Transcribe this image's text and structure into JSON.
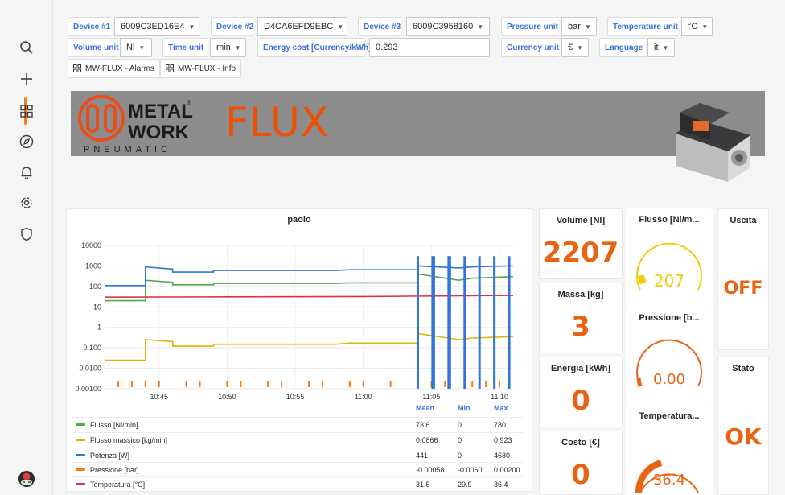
{
  "sidebar": {
    "icons": [
      "search-icon",
      "plus-icon",
      "dashboards-icon",
      "explore-icon",
      "alerting-icon",
      "settings-icon",
      "shield-icon",
      "user-avatar"
    ]
  },
  "variables": {
    "device1": {
      "label": "Device #1",
      "value": "6009C3ED16E4"
    },
    "device2": {
      "label": "Device #2",
      "value": "D4CA6EFD9EBC"
    },
    "device3": {
      "label": "Device #3",
      "value": "6009C3958160"
    },
    "pressure_unit": {
      "label": "Pressure unit",
      "value": "bar"
    },
    "temperature_unit": {
      "label": "Temperature unit",
      "value": "°C"
    },
    "volume_unit": {
      "label": "Volume unit",
      "value": "Nl"
    },
    "time_unit": {
      "label": "Time unit",
      "value": "min"
    },
    "energy_cost": {
      "label": "Energy cost [Currency/kWh]",
      "value": "0.293"
    },
    "currency_unit": {
      "label": "Currency unit",
      "value": "€"
    },
    "language": {
      "label": "Language",
      "value": "it"
    }
  },
  "links": {
    "alarms": "MW-FLUX - Alarms",
    "info": "MW-FLUX - Info"
  },
  "banner": {
    "logo_line1": "METAL",
    "logo_line2": "WORK",
    "logo_sub": "PNEUMATIC",
    "logo_reg": "®",
    "product": "FLUX"
  },
  "chart_panel": {
    "title": "paolo",
    "legend_headers": {
      "mean": "Mean",
      "min": "Min",
      "max": "Max"
    }
  },
  "chart_data": {
    "type": "line",
    "title": "paolo",
    "y_scale": "log",
    "ylim": [
      0.001,
      10000
    ],
    "y_ticks": [
      "10000",
      "1000",
      "100",
      "10",
      "1",
      "0.100",
      "0.0100",
      "0.00100"
    ],
    "x_ticks": [
      "10:45",
      "10:50",
      "10:55",
      "11:00",
      "11:05",
      "11:10"
    ],
    "grid": true,
    "legend_placement": "bottom",
    "series": [
      {
        "name": "Flusso [Nl/min]",
        "color": "#56a64b",
        "mean": "73.6",
        "min": "0",
        "max": "780",
        "x": [
          "10:41",
          "10:44",
          "10:44",
          "10:46",
          "10:46",
          "10:49",
          "10:49",
          "10:58",
          "10:59",
          "11:04",
          "11:04",
          "11:07",
          "11:08",
          "11:11"
        ],
        "y": [
          20,
          20,
          200,
          160,
          120,
          120,
          140,
          140,
          150,
          150,
          400,
          200,
          250,
          300
        ]
      },
      {
        "name": "Flusso massico [kg/min]",
        "color": "#e0b400",
        "mean": "0.0866",
        "min": "0",
        "max": "0.923",
        "x": [
          "10:41",
          "10:44",
          "10:44",
          "10:46",
          "10:46",
          "10:49",
          "10:49",
          "10:58",
          "10:59",
          "11:04",
          "11:04",
          "11:07",
          "11:08",
          "11:11"
        ],
        "y": [
          0.025,
          0.025,
          0.25,
          0.2,
          0.12,
          0.12,
          0.15,
          0.15,
          0.17,
          0.17,
          0.5,
          0.25,
          0.3,
          0.35
        ]
      },
      {
        "name": "Potenza [W]",
        "color": "#3274d9",
        "mean": "441",
        "min": "0",
        "max": "4680",
        "x": [
          "10:41",
          "10:44",
          "10:44",
          "10:46",
          "10:46",
          "10:49",
          "10:49",
          "10:58",
          "10:59",
          "11:04",
          "11:04",
          "11:07",
          "11:08",
          "11:11"
        ],
        "y": [
          110,
          110,
          900,
          700,
          500,
          500,
          600,
          600,
          650,
          650,
          1000,
          800,
          900,
          1000
        ]
      },
      {
        "name": "Pressione [bar]",
        "color": "#ff780a",
        "mean": "-0.00058",
        "min": "-0.0060",
        "max": "0.00200",
        "x": [
          "10:41",
          "11:11"
        ],
        "y": [
          0.001,
          0.001
        ]
      },
      {
        "name": "Temperatura [°C]",
        "color": "#e02f44",
        "mean": "31.5",
        "min": "29.9",
        "max": "36.4",
        "x": [
          "10:41",
          "10:50",
          "11:00",
          "11:11"
        ],
        "y": [
          30,
          31,
          32,
          36
        ]
      }
    ]
  },
  "stats": {
    "volume": {
      "title": "Volume [Nl]",
      "value": "2207"
    },
    "massa": {
      "title": "Massa [kg]",
      "value": "3"
    },
    "energia": {
      "title": "Energia [kWh]",
      "value": "0"
    },
    "costo": {
      "title": "Costo [€]",
      "value": "0"
    }
  },
  "gauges": {
    "flusso": {
      "title": "Flusso [Nl/m...",
      "value": "207"
    },
    "pressione": {
      "title": "Pressione [b...",
      "value": "0.00"
    },
    "temperatura": {
      "title": "Temperatura...",
      "value": "36.4"
    }
  },
  "status": {
    "uscita": {
      "title": "Uscita",
      "value": "OFF"
    },
    "stato": {
      "title": "Stato",
      "value": "OK"
    }
  },
  "colors": {
    "accent": "#e86412",
    "link": "#3871dc",
    "banner": "#8c8c8c",
    "logo_red": "#e84e1b"
  }
}
